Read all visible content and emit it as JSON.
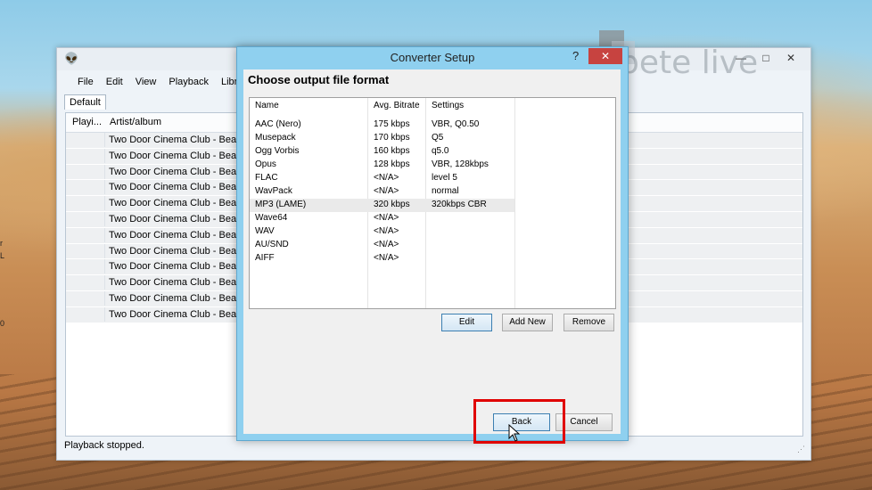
{
  "main_window": {
    "menu": [
      "File",
      "Edit",
      "View",
      "Playback",
      "Librar"
    ],
    "tab": "Default",
    "columns": [
      "Playi...",
      "Artist/album"
    ],
    "rows": [
      "Two Door Cinema Club - Beaco",
      "Two Door Cinema Club - Beaco",
      "Two Door Cinema Club - Beaco",
      "Two Door Cinema Club - Beaco",
      "Two Door Cinema Club - Beaco",
      "Two Door Cinema Club - Beaco",
      "Two Door Cinema Club - Beaco",
      "Two Door Cinema Club - Beaco",
      "Two Door Cinema Club - Beaco",
      "Two Door Cinema Club - Beaco",
      "Two Door Cinema Club - Beaco",
      "Two Door Cinema Club - Beaco"
    ],
    "status": "Playback stopped."
  },
  "watermark": {
    "text": "pete    live"
  },
  "dialog": {
    "title": "Converter Setup",
    "help": "?",
    "close": "✕",
    "heading": "Choose output file format",
    "columns": [
      "Name",
      "Avg. Bitrate",
      "Settings"
    ],
    "formats": [
      {
        "name": "AAC (Nero)",
        "bitrate": "175 kbps",
        "settings": "VBR, Q0.50"
      },
      {
        "name": "Musepack",
        "bitrate": "170 kbps",
        "settings": "Q5"
      },
      {
        "name": "Ogg Vorbis",
        "bitrate": "160 kbps",
        "settings": "q5.0"
      },
      {
        "name": "Opus",
        "bitrate": "128 kbps",
        "settings": "VBR, 128kbps"
      },
      {
        "name": "FLAC",
        "bitrate": "<N/A>",
        "settings": "level 5"
      },
      {
        "name": "WavPack",
        "bitrate": "<N/A>",
        "settings": "normal"
      },
      {
        "name": "MP3 (LAME)",
        "bitrate": "320 kbps",
        "settings": "320kbps CBR"
      },
      {
        "name": "Wave64",
        "bitrate": "<N/A>",
        "settings": ""
      },
      {
        "name": "WAV",
        "bitrate": "<N/A>",
        "settings": ""
      },
      {
        "name": "AU/SND",
        "bitrate": "<N/A>",
        "settings": ""
      },
      {
        "name": "AIFF",
        "bitrate": "<N/A>",
        "settings": ""
      }
    ],
    "selected_format": "MP3 (LAME)",
    "buttons": {
      "edit": "Edit",
      "add_new": "Add New",
      "remove": "Remove",
      "back": "Back",
      "cancel": "Cancel"
    }
  }
}
